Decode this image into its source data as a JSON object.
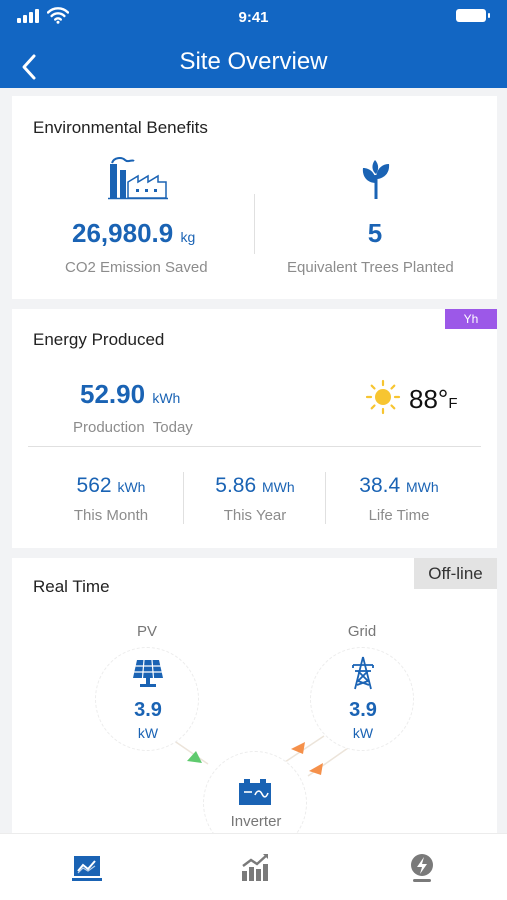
{
  "status_bar": {
    "time": "9:41"
  },
  "header": {
    "title": "Site Overview"
  },
  "environmental": {
    "title": "Environmental Benefits",
    "co2": {
      "value": "26,980.9",
      "unit": "kg",
      "label": "CO2 Emission Saved"
    },
    "trees": {
      "value": "5",
      "label": "Equivalent Trees Planted"
    }
  },
  "energy": {
    "title": "Energy Produced",
    "badge": "Yh",
    "today": {
      "value": "52.90",
      "unit": "kWh",
      "label": "Production  Today"
    },
    "weather": {
      "temp": "88°",
      "unit": "F",
      "icon": "sun-icon"
    },
    "stats": [
      {
        "value": "562",
        "unit": "kWh",
        "label": "This Month"
      },
      {
        "value": "5.86",
        "unit": "MWh",
        "label": "This Year"
      },
      {
        "value": "38.4",
        "unit": "MWh",
        "label": "Life Time"
      }
    ]
  },
  "realtime": {
    "title": "Real Time",
    "status": "Off-line",
    "pv": {
      "label": "PV",
      "value": "3.9",
      "unit": "kW"
    },
    "grid": {
      "label": "Grid",
      "value": "3.9",
      "unit": "kW"
    },
    "inverter": {
      "label": "Inverter"
    }
  },
  "colors": {
    "primary": "#1266c3",
    "accent_blue": "#1a63b4",
    "badge_purple": "#9c58e8",
    "flow_green": "#5fca6e",
    "flow_orange": "#f5904a",
    "sun": "#f7c531"
  },
  "tabbar": {
    "icons": [
      "overview-chart-icon",
      "statistics-icon",
      "device-bolt-icon"
    ]
  }
}
